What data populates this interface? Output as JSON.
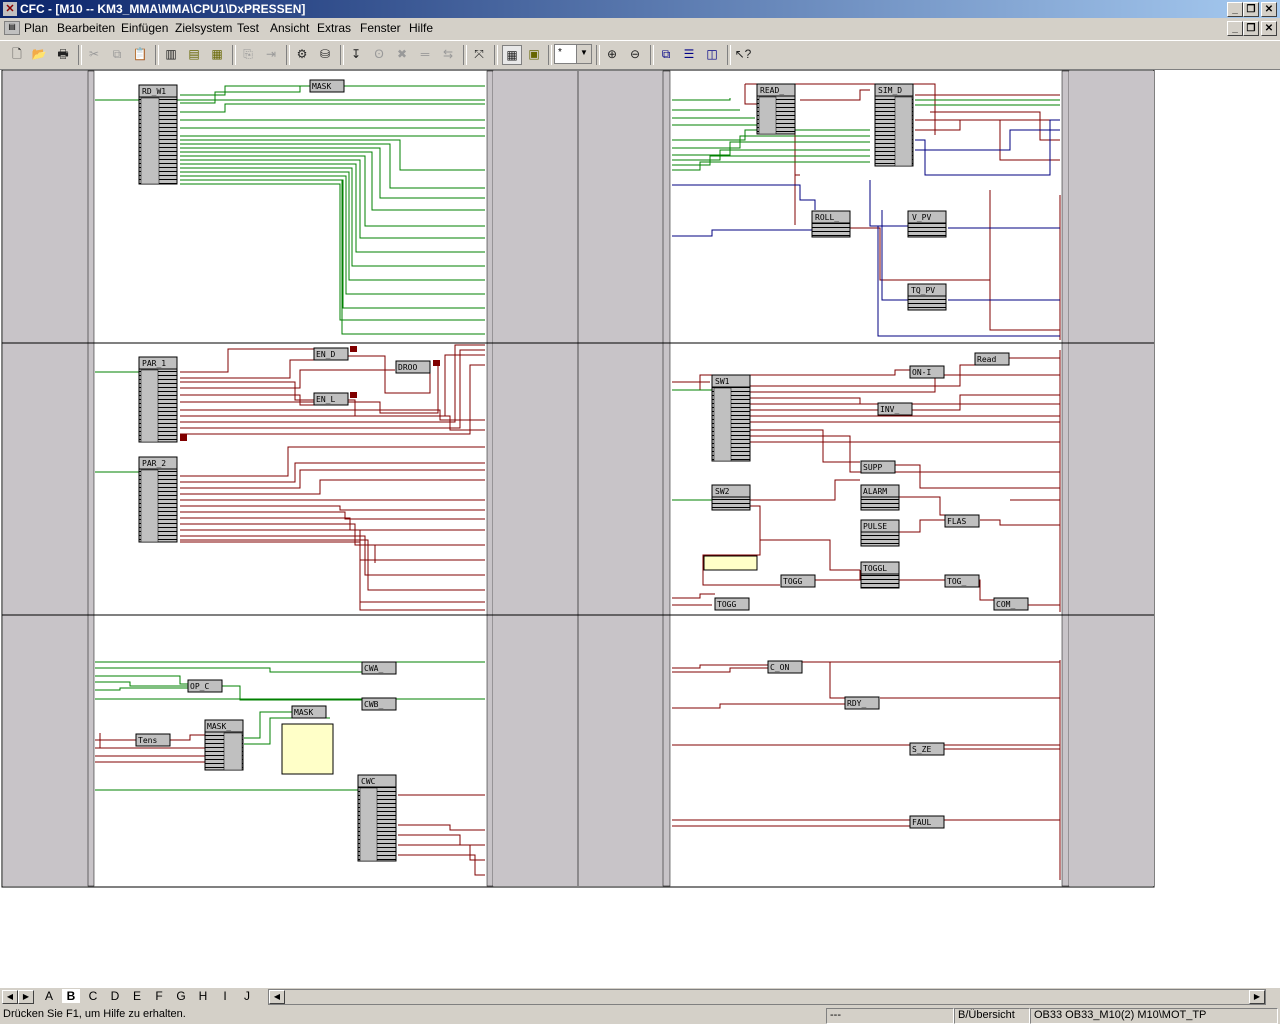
{
  "window": {
    "title": "CFC - [M10 -- KM3_MMA\\MMA\\CPU1\\DxPRESSEN]",
    "app_icon": "cfc-app-icon"
  },
  "menu": [
    "Plan",
    "Bearbeiten",
    "Einfügen",
    "Zielsystem",
    "Test",
    "Ansicht",
    "Extras",
    "Fenster",
    "Hilfe"
  ],
  "toolbar": {
    "zoom_value": "*",
    "icons": [
      "new-icon",
      "open-icon",
      "print-icon",
      "cut-icon",
      "copy-icon",
      "paste-icon",
      "catalog-icon",
      "sheet-icon",
      "sheet-bar-icon",
      "insert-icon",
      "forward-icon",
      "compile-icon",
      "download-icon",
      "connect-icon",
      "run-sequence-icon",
      "delete-connection-icon",
      "wire-icon",
      "wire-text-icon",
      "overview-icon",
      "grid-icon",
      "table-icon",
      "zoom-in-icon",
      "zoom-out-icon",
      "cascade-icon",
      "tile-horizontal-icon",
      "tile-vertical-icon",
      "help-cursor-icon"
    ]
  },
  "blocks": {
    "RD_W1": "RD_W1",
    "MASK_top": "MASK",
    "READ": "READ_",
    "SIM_D": "SIM_D",
    "ROLL": "ROLL_",
    "V_PV": "V_PV",
    "TQ_PV": "TQ_PV",
    "PAR_1": "PAR_1",
    "EN_D": "EN_D",
    "DROO": "DROO",
    "EN_L": "EN_L",
    "PAR_2": "PAR_2",
    "SW1": "SW1",
    "ON_I": "ON-I",
    "Read": "Read",
    "INV": "INV_",
    "SUPP": "SUPP",
    "SW2": "SW2",
    "ALARM": "ALARM",
    "PULSE": "PULSE",
    "FLAS": "FLAS",
    "TOGGL": "TOGGL",
    "TOGG": "TOGG",
    "TOG": "TOG_",
    "TOGG2": "TOGG",
    "COM": "COM_",
    "CWA": "CWA_",
    "OP_C": "OP_C",
    "CWB": "CWB_",
    "MASK_bot": "MASK",
    "MASK_": "MASK_",
    "Tens": "Tens",
    "CWC": "CWC",
    "C_ON": "C_ON",
    "RDY": "RDY_",
    "S_ZE": "S_ZE",
    "FAUL": "FAUL"
  },
  "sheet_tabs": [
    "A",
    "B",
    "C",
    "D",
    "E",
    "F",
    "G",
    "H",
    "I",
    "J"
  ],
  "active_tab": "B",
  "status": {
    "hint": "Drücken Sie F1, um Hilfe zu erhalten.",
    "mode": "---",
    "view": "B/Übersicht",
    "path": "OB33  OB33_M10(2)  M10\\MOT_TP"
  },
  "colors": {
    "green_wire": "#008000",
    "red_wire": "#800000",
    "blue_wire": "#000080",
    "block_fill": "#c0c0c0",
    "border_fill": "#c8c4c8",
    "note_fill": "#ffffc8"
  }
}
